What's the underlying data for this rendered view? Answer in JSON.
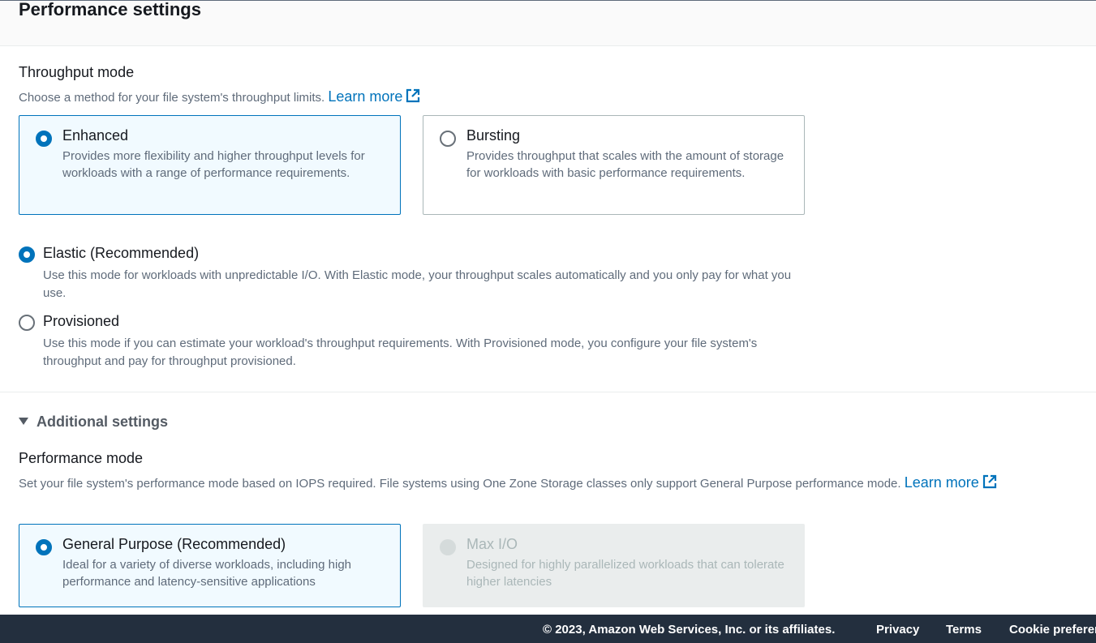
{
  "page": {
    "title": "Performance settings"
  },
  "throughput": {
    "label": "Throughput mode",
    "description": "Choose a method for your file system's throughput limits.",
    "learn_more": "Learn more",
    "tiles": [
      {
        "title": "Enhanced",
        "description": "Provides more flexibility and higher throughput levels for workloads with a range of performance requirements.",
        "selected": true
      },
      {
        "title": "Bursting",
        "description": "Provides throughput that scales with the amount of storage for workloads with basic performance requirements.",
        "selected": false
      }
    ],
    "options": [
      {
        "title": "Elastic (Recommended)",
        "description": "Use this mode for workloads with unpredictable I/O. With Elastic mode, your throughput scales automatically and you only pay for what you use.",
        "selected": true
      },
      {
        "title": "Provisioned",
        "description": "Use this mode if you can estimate your workload's throughput requirements. With Provisioned mode, you configure your file system's throughput and pay for throughput provisioned.",
        "selected": false
      }
    ]
  },
  "additional": {
    "label": "Additional settings",
    "expanded": true
  },
  "performance": {
    "label": "Performance mode",
    "description": "Set your file system's performance mode based on IOPS required. File systems using One Zone Storage classes only support General Purpose performance mode.",
    "learn_more": "Learn more",
    "tiles": [
      {
        "title": "General Purpose (Recommended)",
        "description": "Ideal for a variety of diverse workloads, including high performance and latency-sensitive applications",
        "selected": true
      },
      {
        "title": "Max I/O",
        "description": "Designed for highly parallelized workloads that can tolerate higher latencies",
        "selected": false,
        "disabled": true
      }
    ]
  },
  "footer": {
    "copyright": "© 2023, Amazon Web Services, Inc. or its affiliates.",
    "privacy": "Privacy",
    "terms": "Terms",
    "cookies": "Cookie preferences"
  },
  "colors": {
    "accent": "#0073bb",
    "selected_bg": "#f1faff",
    "footer_bg": "#232f3e",
    "disabled_bg": "#eaeded"
  }
}
